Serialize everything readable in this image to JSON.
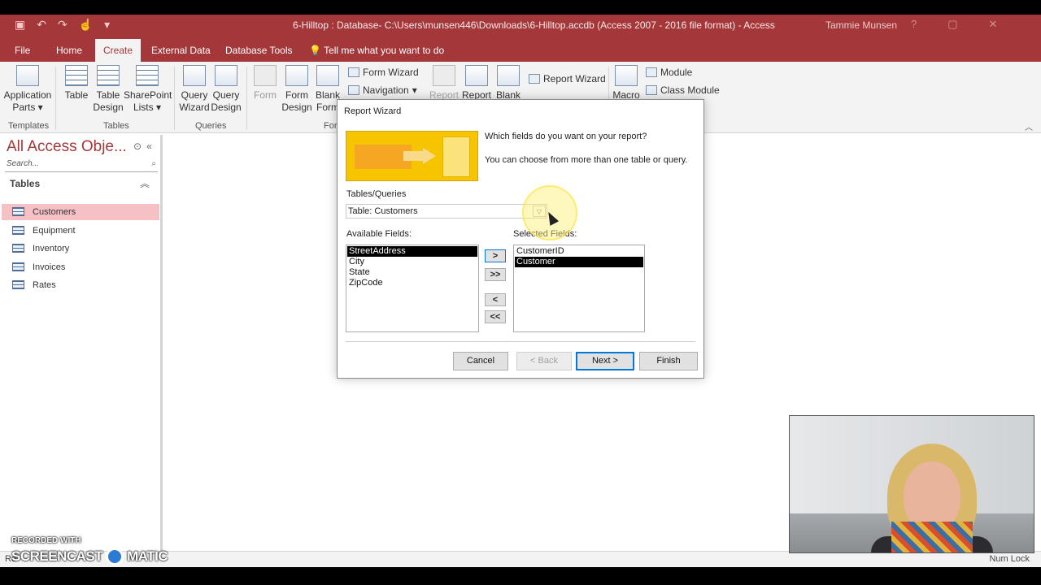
{
  "titlebar": {
    "title": "6-Hilltop : Database- C:\\Users\\munsen446\\Downloads\\6-Hilltop.accdb (Access 2007 - 2016 file format)  -  Access",
    "user": "Tammie Munsen",
    "qat": [
      "save-icon",
      "undo-icon",
      "redo-icon",
      "touch-icon",
      "customize-icon"
    ]
  },
  "menu": {
    "tabs": [
      "File",
      "Home",
      "Create",
      "External Data",
      "Database Tools"
    ],
    "tell_me": "Tell me what you want to do",
    "active": "Create"
  },
  "ribbon": {
    "templates": {
      "application_parts": "Application",
      "application_parts_2": "Parts",
      "group": "Templates"
    },
    "tables": {
      "table": "Table",
      "table_design_1": "Table",
      "table_design_2": "Design",
      "sharepoint_1": "SharePoint",
      "sharepoint_2": "Lists",
      "group": "Tables"
    },
    "queries": {
      "wizard_1": "Query",
      "wizard_2": "Wizard",
      "design_1": "Query",
      "design_2": "Design",
      "group": "Queries"
    },
    "forms": {
      "form": "Form",
      "form_design_1": "Form",
      "form_design_2": "Design",
      "blank_1": "Blank",
      "blank_2": "Form",
      "form_wizard": "Form Wizard",
      "navigation": "Navigation",
      "group": "For"
    },
    "reports": {
      "report": "Report",
      "report_design": "Report",
      "blank": "Blank",
      "report_wizard": "Report Wizard"
    },
    "macros": {
      "macro": "Macro",
      "module": "Module",
      "class_module": "Class Module"
    }
  },
  "navpane": {
    "title": "All Access Obje...",
    "search_placeholder": "Search...",
    "section": "Tables",
    "items": [
      "Customers",
      "Equipment",
      "Inventory",
      "Invoices",
      "Rates"
    ],
    "selected": "Customers"
  },
  "dialog": {
    "title": "Report Wizard",
    "question": "Which fields do you want on your report?",
    "hint": "You can choose from more than one table or query.",
    "tables_label": "Tables/Queries",
    "table_value": "Table: Customers",
    "available_label": "Available Fields:",
    "selected_label": "Selected Fields:",
    "available_fields": [
      "StreetAddress",
      "City",
      "State",
      "ZipCode"
    ],
    "available_selected": "StreetAddress",
    "selected_fields": [
      "CustomerID",
      "Customer"
    ],
    "selected_selected": "Customer",
    "move_buttons": [
      ">",
      ">>",
      "<",
      "<<"
    ],
    "buttons": {
      "cancel": "Cancel",
      "back": "< Back",
      "next": "Next >",
      "finish": "Finish"
    }
  },
  "statusbar": {
    "left": "Re",
    "right": "Num Lock"
  },
  "watermark": {
    "recorded": "RECORDED WITH",
    "brand_left": "SCREENCAST",
    "brand_right": "MATIC"
  },
  "colors": {
    "accent": "#a4373a",
    "selection": "#f6c1c4",
    "focus": "#0078d7"
  }
}
